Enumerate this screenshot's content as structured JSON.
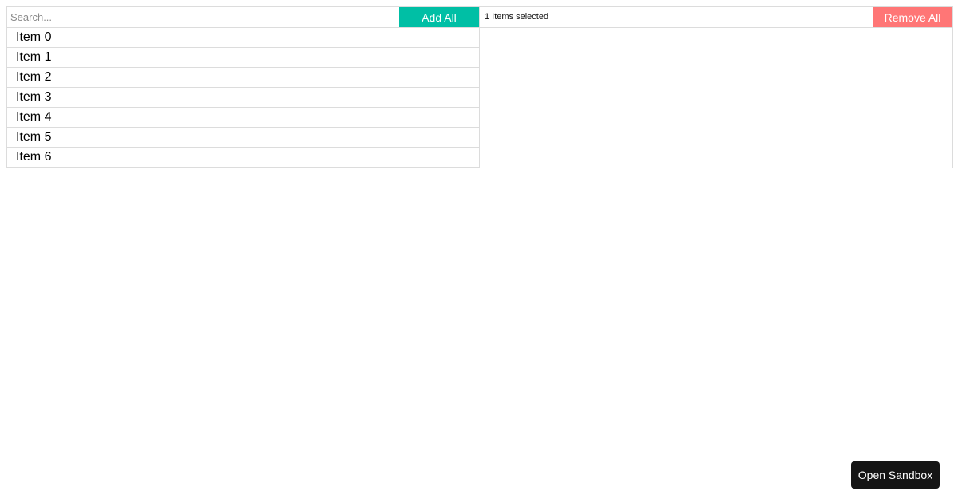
{
  "left_pane": {
    "search_placeholder": "Search...",
    "add_all_label": "Add All",
    "items": [
      {
        "label": "Item 0"
      },
      {
        "label": "Item 1"
      },
      {
        "label": "Item 2"
      },
      {
        "label": "Item 3"
      },
      {
        "label": "Item 4"
      },
      {
        "label": "Item 5"
      },
      {
        "label": "Item 6"
      }
    ]
  },
  "right_pane": {
    "selected_count_text": "1 Items selected",
    "remove_all_label": "Remove All",
    "items": []
  },
  "open_sandbox_label": "Open Sandbox",
  "colors": {
    "add_all_button": "#00bfa5",
    "remove_all_button": "#ff7676",
    "sandbox_button": "#151515",
    "border": "#dcdcdc"
  }
}
